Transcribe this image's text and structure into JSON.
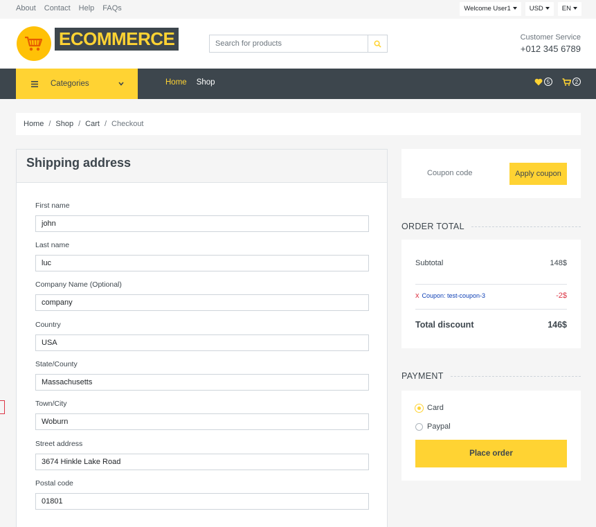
{
  "topbar": {
    "links": [
      "About",
      "Contact",
      "Help",
      "FAQs"
    ],
    "user": "Welcome User1",
    "currency": "USD",
    "language": "EN"
  },
  "header": {
    "logo_text": "ECOMMERCE",
    "search_placeholder": "Search for products",
    "service_label": "Customer Service",
    "service_phone": "+012 345 6789"
  },
  "nav": {
    "categories_label": "Categories",
    "links": [
      "Home",
      "Shop"
    ],
    "wishlist_count": "5",
    "cart_count": "2",
    "accent_color": "#ffd333",
    "dark_color": "#3d464d"
  },
  "breadcrumb": [
    "Home",
    "Shop",
    "Cart",
    "Checkout"
  ],
  "shipping": {
    "title": "Shipping address",
    "fields": [
      {
        "label": "First name",
        "value": "john"
      },
      {
        "label": "Last name",
        "value": "luc"
      },
      {
        "label": "Company Name (Optional)",
        "value": "company"
      },
      {
        "label": "Country",
        "value": "USA"
      },
      {
        "label": "State/County",
        "value": "Massachusetts"
      },
      {
        "label": "Town/City",
        "value": "Woburn"
      },
      {
        "label": "Street address",
        "value": "3674 Hinkle Lake Road"
      },
      {
        "label": "Postal code",
        "value": "01801"
      }
    ]
  },
  "coupon": {
    "placeholder": "Coupon code",
    "button": "Apply coupon"
  },
  "order_total": {
    "heading": "ORDER TOTAL",
    "subtotal_label": "Subtotal",
    "subtotal_value": "148$",
    "coupon_remove": "x",
    "coupon_label": "Coupon: test-coupon-3",
    "coupon_value": "-2$",
    "total_label": "Total discount",
    "total_value": "146$"
  },
  "payment": {
    "heading": "PAYMENT",
    "options": [
      "Card",
      "Paypal"
    ],
    "selected": "Card",
    "button": "Place order"
  }
}
